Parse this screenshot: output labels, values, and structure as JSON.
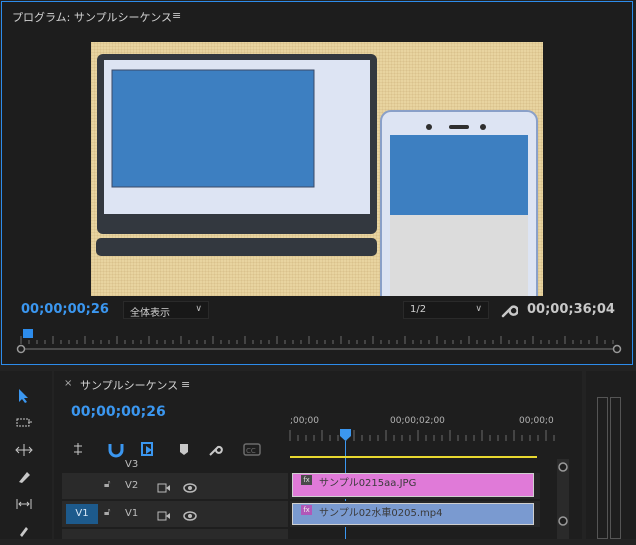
{
  "program": {
    "title": "プログラム: サンプルシーケンス",
    "menu": "≡",
    "current_timecode": "00;00;00;26",
    "zoom": "全体表示",
    "resolution": "1/2",
    "duration": "00;00;36;04"
  },
  "timeline": {
    "close": "×",
    "sequence_tab": "サンプルシーケンス",
    "menu": "≡",
    "timecode": "00;00;00;26",
    "ruler": [
      ";00;00",
      "00;00;02;00",
      "00;00;0"
    ],
    "tracks": [
      {
        "name": "V3",
        "selected": false
      },
      {
        "name": "V2",
        "selected": false
      },
      {
        "name": "V1",
        "selected": true,
        "source": "V1"
      }
    ],
    "clips": [
      {
        "track": "V2",
        "fx": "fx",
        "name": "サンプル0215aa.JPG",
        "color": "#e07ad8"
      },
      {
        "track": "V1",
        "fx": "fx",
        "name": "サンプル02水車0205.mp4",
        "color": "#7a9ad0"
      }
    ]
  },
  "tools": [
    "selection-tool",
    "track-select-tool",
    "ripple-edit-tool",
    "razor-tool",
    "slip-tool",
    "pen-tool"
  ],
  "colors": {
    "accent": "#2d8ceb",
    "timecode": "#3b97f0",
    "clip_v2": "#e07ad8",
    "clip_v1": "#7a9ad0"
  }
}
